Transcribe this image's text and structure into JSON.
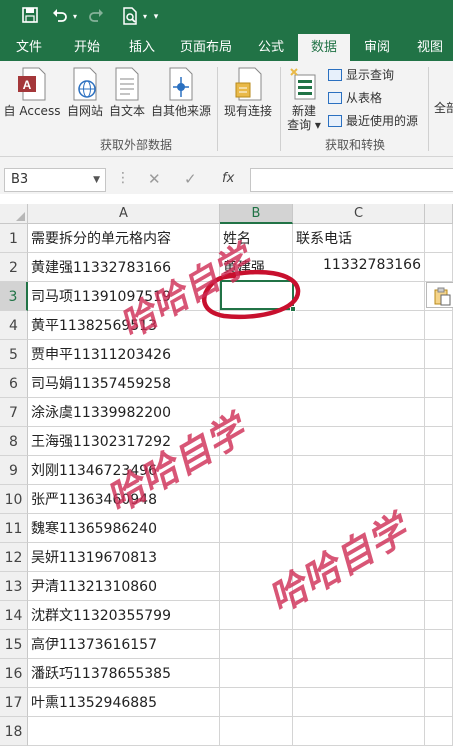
{
  "quick_access": {
    "save_icon": "save-icon",
    "undo_icon": "undo-icon",
    "redo_icon": "redo-icon",
    "print_preview_icon": "print-preview-icon",
    "customize_icon": "customize-qat-icon"
  },
  "tabs": [
    {
      "label": "文件"
    },
    {
      "label": "开始"
    },
    {
      "label": "插入"
    },
    {
      "label": "页面布局"
    },
    {
      "label": "公式"
    },
    {
      "label": "数据",
      "active": true
    },
    {
      "label": "审阅"
    },
    {
      "label": "视图"
    }
  ],
  "ribbon": {
    "external_data": {
      "from_access": "自 Access",
      "from_web": "自网站",
      "from_text": "自文本",
      "from_other": "自其他来源",
      "group_label": "获取外部数据"
    },
    "existing_connections": "现有连接",
    "transform": {
      "new_query": "新建",
      "new_query_sub": "查询 ▾",
      "show_queries": "显示查询",
      "from_table": "从表格",
      "recent_sources": "最近使用的源",
      "group_label": "获取和转换"
    },
    "refresh_all": "全部"
  },
  "formula_bar": {
    "name_box": "B3",
    "fx_label": "fx",
    "dots": "⋮",
    "cancel_label": "✕",
    "enter_label": "✓",
    "formula": ""
  },
  "columns": [
    "A",
    "B",
    "C"
  ],
  "rows": [
    {
      "num": "1",
      "a": "需要拆分的单元格内容",
      "b": "姓名",
      "c": "联系电话"
    },
    {
      "num": "2",
      "a": "黄建强11332783166",
      "b": "黄建强",
      "c": "11332783166"
    },
    {
      "num": "3",
      "a": "司马项11391097519",
      "b": "",
      "c": ""
    },
    {
      "num": "4",
      "a": "黄平11382569513",
      "b": "",
      "c": ""
    },
    {
      "num": "5",
      "a": "贾申平11311203426",
      "b": "",
      "c": ""
    },
    {
      "num": "6",
      "a": "司马娟11357459258",
      "b": "",
      "c": ""
    },
    {
      "num": "7",
      "a": "涂泳虞11339982200",
      "b": "",
      "c": ""
    },
    {
      "num": "8",
      "a": "王海强11302317292",
      "b": "",
      "c": ""
    },
    {
      "num": "9",
      "a": "刘刚11346723496",
      "b": "",
      "c": ""
    },
    {
      "num": "10",
      "a": "张严11363460948",
      "b": "",
      "c": ""
    },
    {
      "num": "11",
      "a": "魏寒11365986240",
      "b": "",
      "c": ""
    },
    {
      "num": "12",
      "a": "吴妍11319670813",
      "b": "",
      "c": ""
    },
    {
      "num": "13",
      "a": "尹清11321310860",
      "b": "",
      "c": ""
    },
    {
      "num": "14",
      "a": "沈群文11320355799",
      "b": "",
      "c": ""
    },
    {
      "num": "15",
      "a": "高伊11373616157",
      "b": "",
      "c": ""
    },
    {
      "num": "16",
      "a": "潘跃巧11378655385",
      "b": "",
      "c": ""
    },
    {
      "num": "17",
      "a": "叶熏11352946885",
      "b": "",
      "c": ""
    },
    {
      "num": "18",
      "a": "",
      "b": "",
      "c": ""
    }
  ],
  "selected_cell": "B3",
  "watermark_text": "哈哈自学",
  "colors": {
    "excel_green": "#217346",
    "watermark": "#cf2c55",
    "highlight_circle": "#c8102e"
  }
}
